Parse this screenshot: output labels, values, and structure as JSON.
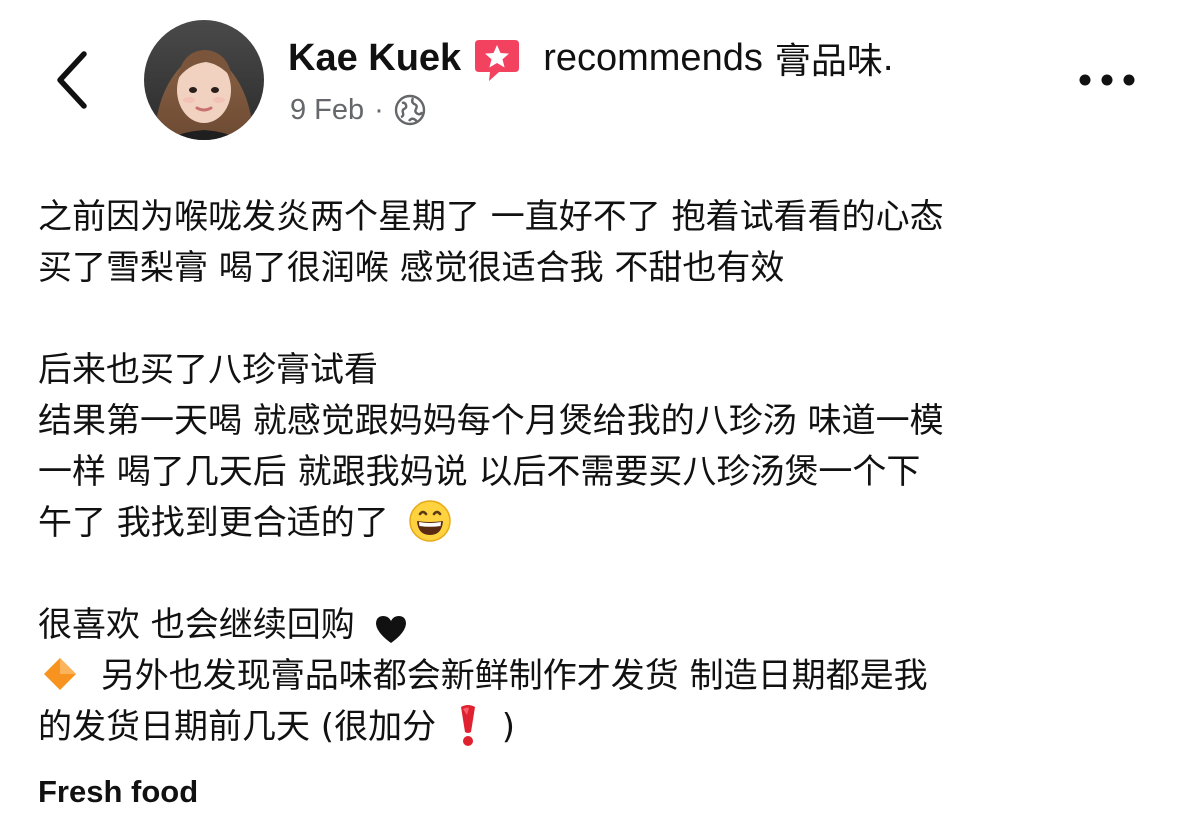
{
  "header": {
    "author_name": "Kae Kuek",
    "recommends_text": "recommends",
    "page_name": "膏品味",
    "page_name_suffix": ".",
    "date": "9 Feb",
    "meta_separator": "·",
    "audience_icon": "globe-icon",
    "recommend_icon": "recommend-star-icon",
    "back_icon": "chevron-left-icon",
    "more_icon": "more-dots-icon"
  },
  "post": {
    "lines": [
      "之前因为喉咙发炎两个星期了 一直好不了 抱着试看看的心态",
      "买了雪梨膏 喝了很润喉 感觉很适合我 不甜也有效",
      "后来也买了八珍膏试看",
      "结果第一天喝 就感觉跟妈妈每个月煲给我的八珍汤 味道一模",
      "一样 喝了几天后 就跟我妈说 以后不需要买八珍汤煲一个下",
      "午了 我找到更合适的了",
      "很喜欢 也会继续回购",
      "另外也发现膏品味都会新鲜制作才发货 制造日期都是我",
      "的发货日期前几天 (很加分",
      ")"
    ],
    "emojis": {
      "grin": "grinning-face-emoji",
      "heart": "black-heart-emoji",
      "diamond": "orange-diamond-emoji",
      "exclaim": "red-exclamation-emoji"
    }
  },
  "tag": {
    "label": "Fresh food"
  },
  "colors": {
    "text": "#111111",
    "meta": "#65676b",
    "recommend_badge": "#f3425f",
    "diamond": "#f7931e",
    "exclaim": "#e0212f"
  }
}
